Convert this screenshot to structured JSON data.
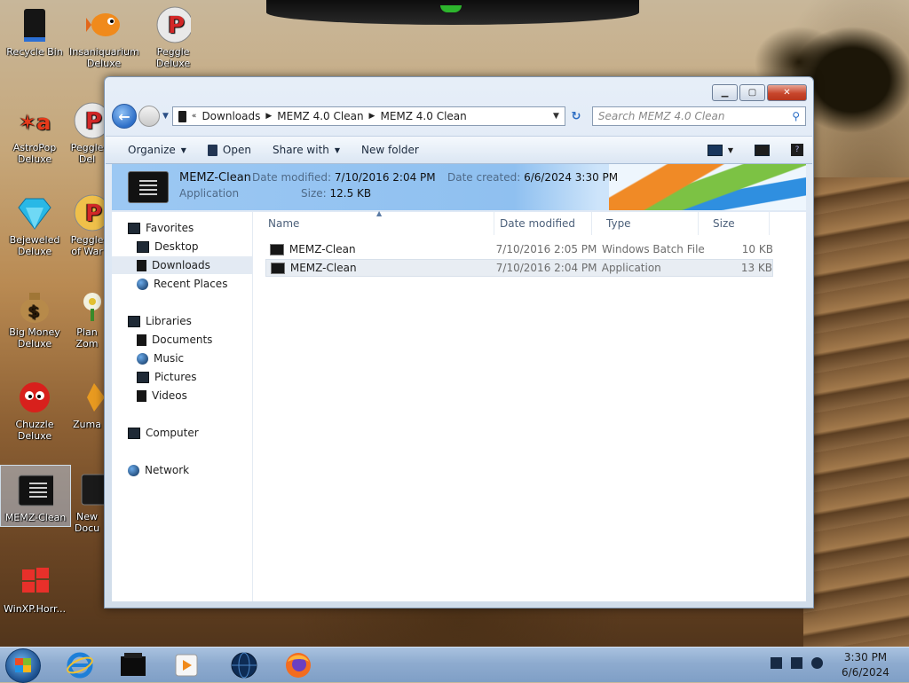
{
  "desktop": {
    "icons": [
      {
        "label": "Recycle Bin",
        "icon": "recycle-bin-icon"
      },
      {
        "label": "Insaniquarium Deluxe",
        "icon": "fish-icon"
      },
      {
        "label": "Peggle Deluxe",
        "icon": "peggle-icon"
      },
      {
        "label": "AstroPop Deluxe",
        "icon": "astropop-icon"
      },
      {
        "label": "Peggle Del",
        "icon": "peggle-icon"
      },
      {
        "label": "Bejeweled Deluxe",
        "icon": "gem-icon"
      },
      {
        "label": "Peggle of War",
        "icon": "peggle-icon"
      },
      {
        "label": "Big Money Deluxe",
        "icon": "money-bag-icon"
      },
      {
        "label": "Plan Zom",
        "icon": "flower-icon"
      },
      {
        "label": "Chuzzle Deluxe",
        "icon": "chuzzle-icon"
      },
      {
        "label": "Zuma",
        "icon": "zuma-icon"
      },
      {
        "label": "MEMZ-Clean",
        "icon": "batch-file-icon"
      },
      {
        "label": "New Docu",
        "icon": "document-icon"
      },
      {
        "label": "WinXP.Horr...",
        "icon": "windows-logo-icon"
      }
    ]
  },
  "window": {
    "address": {
      "crumbs": [
        "Downloads",
        "MEMZ 4.0 Clean",
        "MEMZ 4.0 Clean"
      ],
      "search_placeholder": "Search MEMZ 4.0 Clean"
    },
    "toolbar": {
      "organize": "Organize",
      "open": "Open",
      "share_with": "Share with",
      "new_folder": "New folder"
    },
    "details": {
      "name": "MEMZ-Clean",
      "type": "Application",
      "date_modified_label": "Date modified:",
      "date_modified": "7/10/2016 2:04 PM",
      "size_label": "Size:",
      "size": "12.5 KB",
      "date_created_label": "Date created:",
      "date_created": "6/6/2024 3:30 PM"
    },
    "nav": {
      "favorites": "Favorites",
      "desktop": "Desktop",
      "downloads": "Downloads",
      "recent_places": "Recent Places",
      "libraries": "Libraries",
      "documents": "Documents",
      "music": "Music",
      "pictures": "Pictures",
      "videos": "Videos",
      "computer": "Computer",
      "network": "Network"
    },
    "columns": {
      "name": "Name",
      "date_modified": "Date modified",
      "type": "Type",
      "size": "Size"
    },
    "files": [
      {
        "name": "MEMZ-Clean",
        "date": "7/10/2016 2:05 PM",
        "type": "Windows Batch File",
        "size": "10 KB"
      },
      {
        "name": "MEMZ-Clean",
        "date": "7/10/2016 2:04 PM",
        "type": "Application",
        "size": "13 KB"
      }
    ]
  },
  "taskbar": {
    "apps": [
      "internet-explorer-icon",
      "terminal-icon",
      "media-player-icon",
      "globe-icon",
      "firefox-icon"
    ],
    "time": "3:30 PM",
    "date": "6/6/2024"
  }
}
